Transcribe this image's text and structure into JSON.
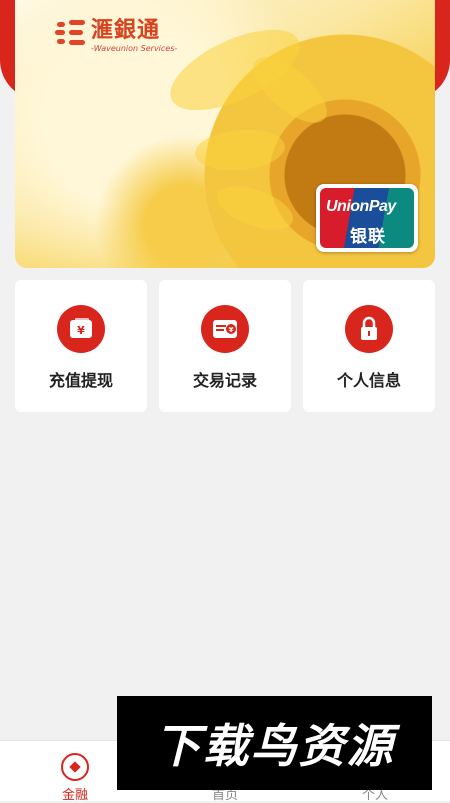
{
  "brand": {
    "name": "滙銀通",
    "subtitle": "-Waveunion Services-",
    "card_network_en": "UnionPay",
    "card_network_cn": "银联"
  },
  "tiles": [
    {
      "label": "充值提现",
      "icon": "yen-wallet-icon"
    },
    {
      "label": "交易记录",
      "icon": "yen-receipt-icon"
    },
    {
      "label": "个人信息",
      "icon": "lock-icon"
    }
  ],
  "bottom_nav": [
    {
      "label": "金融",
      "icon": "finance-icon",
      "active": true
    },
    {
      "label": "首页",
      "icon": "home-icon",
      "active": false
    },
    {
      "label": "个人",
      "icon": "profile-icon",
      "active": false
    }
  ],
  "watermark": "下载鸟资源",
  "colors": {
    "accent": "#d8261d",
    "background": "#f1f1f1"
  }
}
